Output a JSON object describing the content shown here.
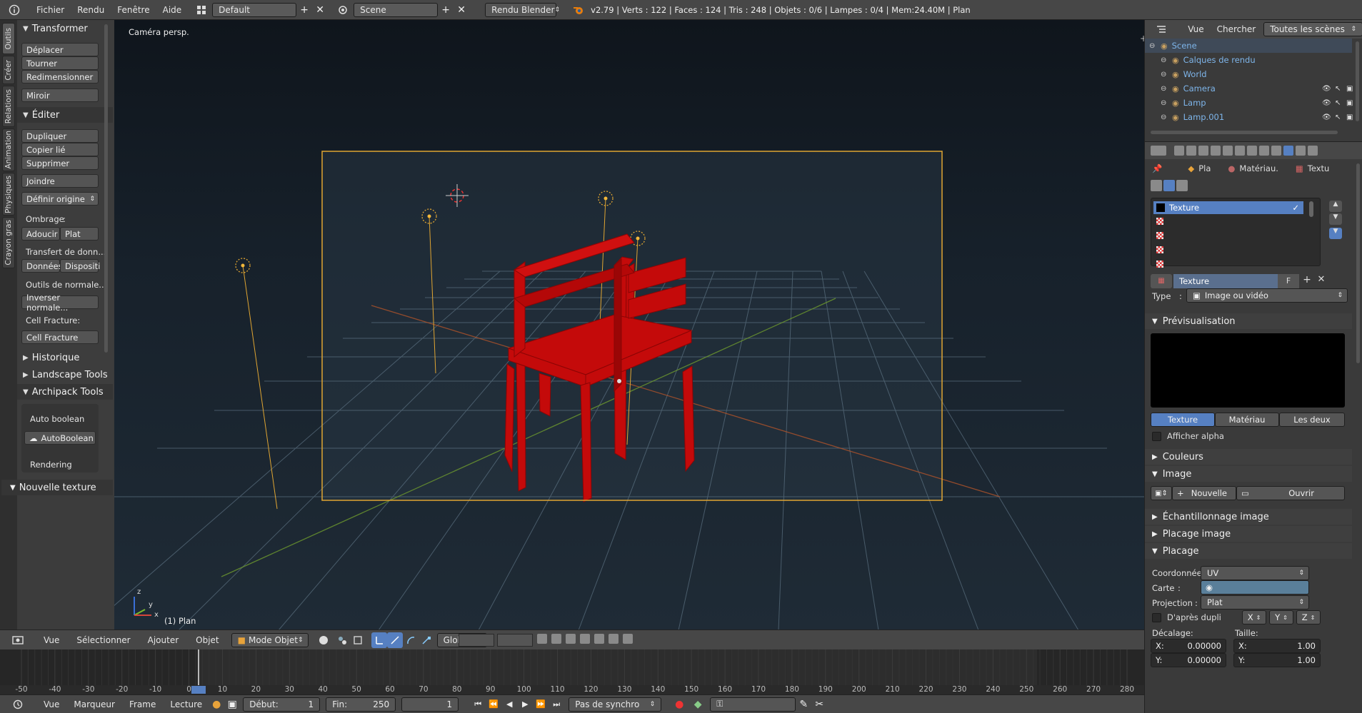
{
  "topbar": {
    "info_icon": "info-icon",
    "menus": [
      "Fichier",
      "Rendu",
      "Fenêtre",
      "Aide"
    ],
    "layout_name": "Default",
    "scene_name": "Scene",
    "render_engine": "Rendu Blender",
    "stats": "v2.79 | Verts : 122 | Faces : 124 | Tris : 248 | Objets : 0/6 | Lampes : 0/4 | Mem:24.40M | Plan"
  },
  "left_tabs": [
    "Outils",
    "Créer",
    "Relations",
    "Animation",
    "Physiques",
    "Crayon gras"
  ],
  "tools": {
    "transform_title": "Transformer",
    "transform_buttons": [
      "Déplacer",
      "Tourner",
      "Redimensionner",
      "Miroir"
    ],
    "edit_title": "Éditer",
    "edit_buttons": [
      "Dupliquer",
      "Copier lié",
      "Supprimer",
      "Joindre"
    ],
    "set_origin": "Définir origine",
    "shading_label": "Ombrage",
    "shading_colon": ":",
    "smooth": "Adoucir",
    "flat": "Plat",
    "data_transfer": "Transfert de donn...",
    "data": "Données",
    "layout": "Dispositi",
    "normals_tools": "Outils de normale...",
    "invert_normals": "Inverser normale...",
    "cell_fracture_label": "Cell Fracture:",
    "cell_fracture": "Cell Fracture",
    "history": "Historique",
    "landscape": "Landscape Tools",
    "archipack": "Archipack Tools",
    "auto_boolean_label": "Auto boolean",
    "auto_boolean_btn": "AutoBoolean",
    "rendering": "Rendering",
    "new_texture": "Nouvelle texture"
  },
  "viewport": {
    "view_name": "Caméra persp.",
    "object_label": "(1) Plan",
    "axis_z": "z",
    "axis_y": "y",
    "axis_x": "x"
  },
  "viewport_header": {
    "menus": [
      "Vue",
      "Sélectionner",
      "Ajouter",
      "Objet"
    ],
    "mode": "Mode Objet",
    "orientation": "Global"
  },
  "timeline": {
    "ticks": [
      "-50",
      "-40",
      "-30",
      "-20",
      "-10",
      "0",
      "10",
      "20",
      "30",
      "40",
      "50",
      "60",
      "70",
      "80",
      "90",
      "100",
      "110",
      "120",
      "130",
      "140",
      "150",
      "160",
      "170",
      "180",
      "190",
      "200",
      "210",
      "220",
      "230",
      "240",
      "250",
      "260",
      "270",
      "280"
    ],
    "current_frame_marker": 1
  },
  "timeline_header": {
    "menus": [
      "Vue",
      "Marqueur",
      "Frame",
      "Lecture"
    ],
    "start_label": "Début:",
    "start_value": "1",
    "end_label": "Fin:",
    "end_value": "250",
    "current_frame": "1",
    "sync": "Pas de synchro"
  },
  "outliner": {
    "menus": [
      "Vue",
      "Chercher"
    ],
    "filter": "Toutes les scènes",
    "items": [
      {
        "label": "Scene",
        "icon": "scene-icon",
        "depth": 0
      },
      {
        "label": "Calques de rendu",
        "icon": "render-layers-icon",
        "depth": 1
      },
      {
        "label": "World",
        "icon": "world-icon",
        "depth": 1
      },
      {
        "label": "Camera",
        "icon": "camera-icon",
        "depth": 1
      },
      {
        "label": "Lamp",
        "icon": "lamp-icon",
        "depth": 1
      },
      {
        "label": "Lamp.001",
        "icon": "lamp-icon",
        "depth": 1
      }
    ]
  },
  "properties": {
    "breadcrumb": [
      "Pla",
      "Matériau.",
      "Textu"
    ],
    "texture_slots": [
      "Texture",
      "",
      "",
      "",
      ""
    ],
    "texture_name": "Texture",
    "fake_user": "F",
    "type_label": "Type",
    "type_colon": ":",
    "type_value": "Image ou vidéo",
    "preview_title": "Prévisualisation",
    "preview_tabs": [
      "Texture",
      "Matériau",
      "Les deux"
    ],
    "show_alpha": "Afficher alpha",
    "colors_title": "Couleurs",
    "image_title": "Image",
    "new_btn": "Nouvelle",
    "open_btn": "Ouvrir",
    "sampling_title": "Échantillonnage image",
    "mapping_image_title": "Placage image",
    "mapping_title": "Placage",
    "coords_label": "Coordonnée...",
    "coords_value": "UV",
    "map_label": "Carte",
    "map_colon": ":",
    "projection_label": "Projection",
    "projection_colon": ":",
    "projection_value": "Plat",
    "dupli_label": "D'après dupli",
    "axes": [
      "X",
      "Y",
      "Z"
    ],
    "offset_label": "Décalage:",
    "size_label": "Taille:",
    "offset_x_label": "X:",
    "offset_x": "0.00000",
    "offset_y_label": "Y:",
    "offset_y": "0.00000",
    "size_x_label": "X:",
    "size_x": "1.00",
    "size_y_label": "Y:",
    "size_y": "1.00"
  },
  "colors": {
    "accent_blue": "#5680c2",
    "chair_red": "#c40a0a",
    "camera_frame": "#e8a33a",
    "outliner_text": "#7eb5ea"
  }
}
